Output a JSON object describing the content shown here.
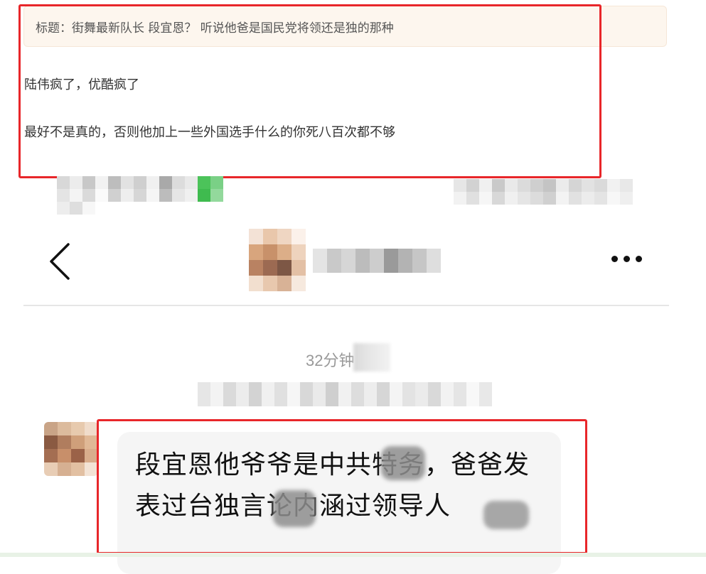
{
  "post": {
    "title": "标题：街舞最新队长 段宜恩？ 听说他爸是国民党将领还是独的那种",
    "line1": "陆伟疯了，优酷疯了",
    "line2": "最好不是真的，否则他加上一些外国选手什么的你死八百次都不够"
  },
  "chat": {
    "back_icon": "chevron-left-icon",
    "more_icon": "more-dots-icon",
    "time_label": "32分钟",
    "message": "段宜恩他爷爷是中共特务，爸爸发表过台独言论内涵过领导人"
  },
  "colors": {
    "highlight_border": "#e8262a",
    "title_bg": "#fdf6ee",
    "bubble_bg": "#f5f5f5"
  }
}
